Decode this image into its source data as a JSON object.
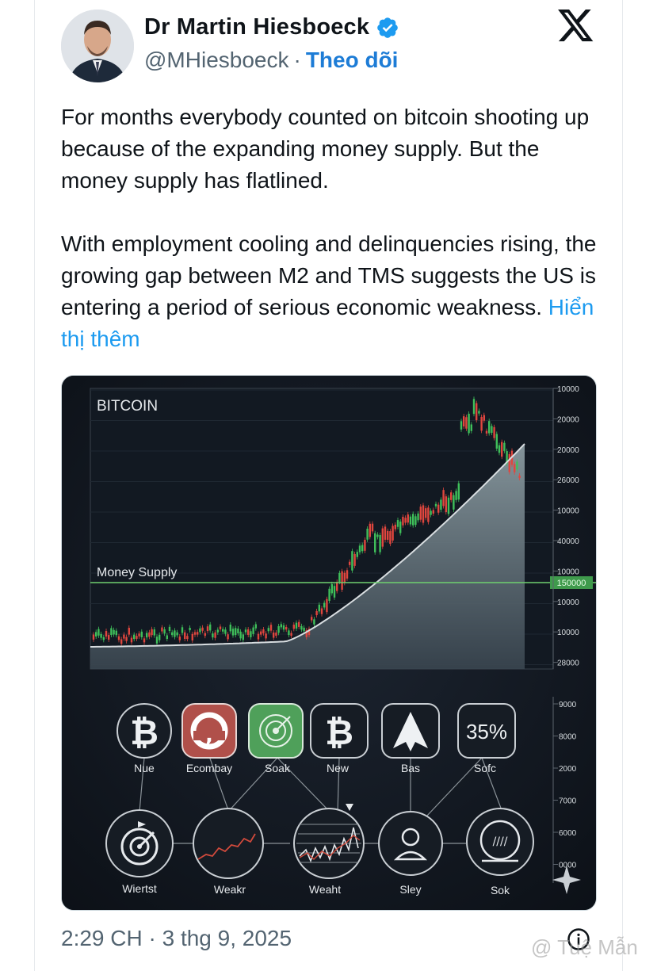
{
  "author": {
    "name": "Dr Martin Hiesboeck",
    "handle": "@MHiesboeck",
    "separator": "·",
    "follow_label": "Theo dõi"
  },
  "post": {
    "paragraph1": "For months everybody counted on bitcoin shooting up because of the expanding money supply. But the money supply has flatlined.",
    "paragraph2": "With employment cooling and delinquencies rising, the growing gap between M2 and TMS suggests the US is entering a period of serious economic weakness.",
    "show_more": "Hiển thị thêm",
    "timestamp": "2:29 CH · 3 thg 9, 2025"
  },
  "watermark": "@ Tuệ Mẫn",
  "icons": {
    "verified": "verified-badge-icon",
    "platform": "x-logo-icon",
    "info": "info-icon"
  },
  "colors": {
    "accent": "#1d9bf0",
    "follow": "#1d7cd6",
    "candle_up": "#3fbf5a",
    "candle_down": "#e0463e",
    "money_supply_line": "#6fd06f"
  },
  "chart_data": {
    "type": "line",
    "title": "BITCOIN",
    "line_label": "Money Supply",
    "right_axis_ticks": [
      "10000",
      "20000",
      "20000",
      "26000",
      "10000",
      "40000",
      "10000",
      "10000",
      "10000",
      "28000"
    ],
    "highlight_tick": "150000",
    "lower_axis_ticks": [
      "9000",
      "8000",
      "2000",
      "7000",
      "6000",
      "0000"
    ]
  },
  "media": {
    "top_icons": [
      {
        "label": "Nue",
        "glyph": "₿",
        "icon": "bitcoin-icon"
      },
      {
        "label": "Ecombay",
        "glyph": "",
        "icon": "shield-icon"
      },
      {
        "label": "Soak",
        "glyph": "",
        "icon": "target-icon"
      },
      {
        "label": "New",
        "glyph": "₿",
        "icon": "bitcoin-icon"
      },
      {
        "label": "Bas",
        "glyph": "",
        "icon": "arrow-up-icon"
      },
      {
        "label": "Sofc",
        "glyph": "35%",
        "icon": "percent-icon"
      }
    ],
    "bottom_icons": [
      {
        "label": "Wiertst",
        "icon": "target-arrow-icon"
      },
      {
        "label": "Weakr",
        "icon": "line-chart-icon"
      },
      {
        "label": "Weaht",
        "icon": "candlestick-icon"
      },
      {
        "label": "Sley",
        "icon": "user-icon"
      },
      {
        "label": "Sok",
        "icon": "gauge-icon"
      }
    ]
  }
}
